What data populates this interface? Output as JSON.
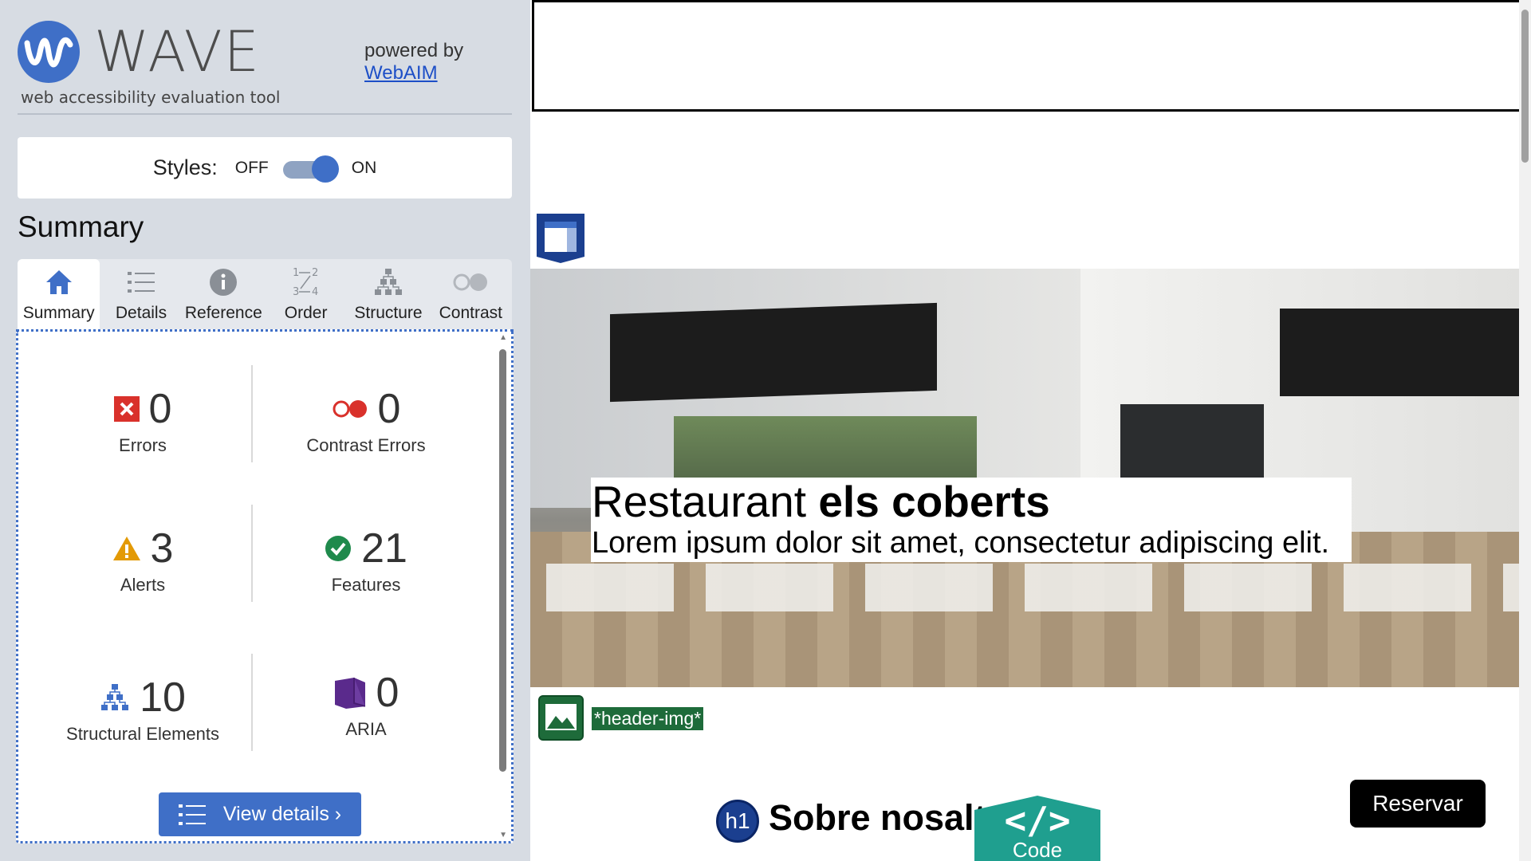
{
  "brand": {
    "name": "WAVE",
    "tagline": "web accessibility evaluation tool",
    "powered_by": "powered by",
    "webaim_link": "WebAIM"
  },
  "styles_toggle": {
    "label": "Styles:",
    "off": "OFF",
    "on": "ON",
    "state": "on"
  },
  "summary": {
    "heading": "Summary",
    "tabs": [
      {
        "label": "Summary",
        "icon": "home-icon",
        "active": true
      },
      {
        "label": "Details",
        "icon": "list-icon"
      },
      {
        "label": "Reference",
        "icon": "info-icon"
      },
      {
        "label": "Order",
        "icon": "order-icon"
      },
      {
        "label": "Structure",
        "icon": "structure-icon"
      },
      {
        "label": "Contrast",
        "icon": "contrast-icon"
      }
    ],
    "stats": {
      "errors": {
        "value": "0",
        "label": "Errors"
      },
      "contrast_errors": {
        "value": "0",
        "label": "Contrast Errors"
      },
      "alerts": {
        "value": "3",
        "label": "Alerts"
      },
      "features": {
        "value": "21",
        "label": "Features"
      },
      "structural": {
        "value": "10",
        "label": "Structural Elements"
      },
      "aria": {
        "value": "0",
        "label": "ARIA"
      }
    },
    "view_details": "View details ›"
  },
  "colors": {
    "accent": "#3f6fc7",
    "error": "#d9312b",
    "alert": "#e39a06",
    "feature": "#1f8a4c",
    "aria": "#5a2a8c",
    "code_tab": "#1f9f8f"
  },
  "preview": {
    "hero_title_regular": "Restaurant ",
    "hero_title_bold": "els coberts",
    "hero_subtitle": "Lorem ipsum dolor sit amet, consectetur adipiscing elit.",
    "alt_text_label": "*header-img*",
    "reservar_button": "Reservar",
    "h1_badge": "h1",
    "section_heading": "Sobre nosaltr",
    "code_tab_glyph": "</>",
    "code_tab_label": "Code"
  }
}
